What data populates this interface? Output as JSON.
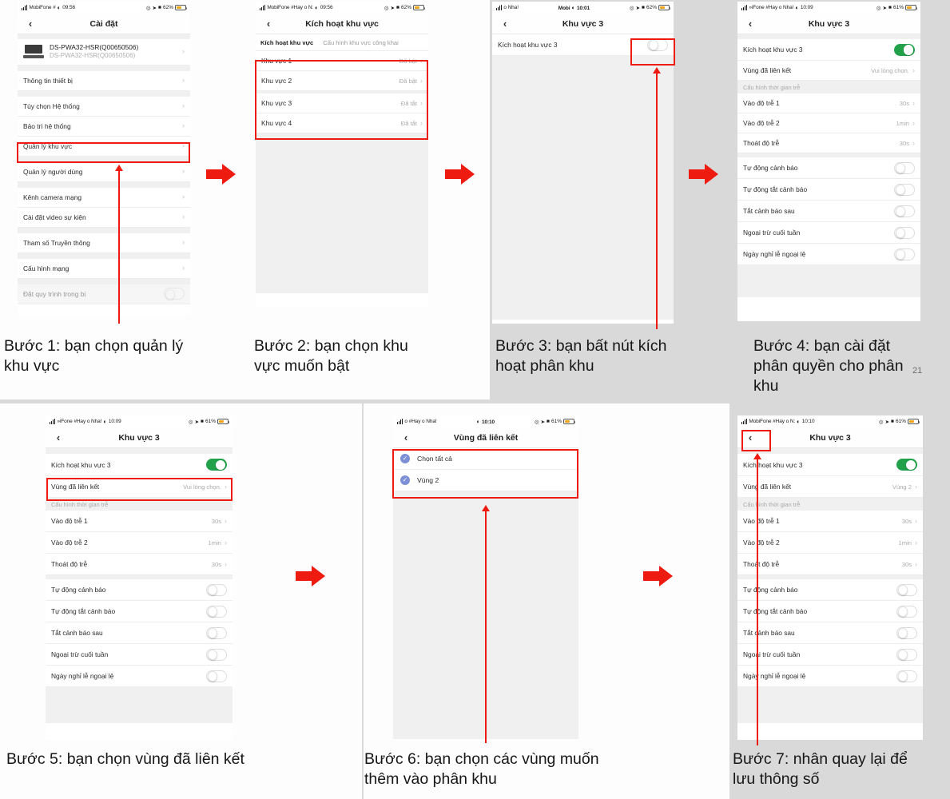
{
  "document": {
    "page_number": "21",
    "accent_color": "#ee1b11",
    "toggle_on_color": "#22a04a",
    "checkbox_color": "#7d8fd6"
  },
  "captions": [
    {
      "id": "step1",
      "text": "Bước 1: bạn chọn quản lý khu vực"
    },
    {
      "id": "step2",
      "text": "Bước 2: bạn chọn khu vực muốn bật"
    },
    {
      "id": "step3",
      "text": "Bước 3: bạn bất nút kích hoạt phân khu"
    },
    {
      "id": "step4",
      "text": "Bước 4: bạn cài đặt phân quyền cho phân khu"
    },
    {
      "id": "step5",
      "text": "Bước 5: bạn chọn vùng đã liên kết"
    },
    {
      "id": "step6",
      "text": "Bước 6: bạn chọn các vùng muốn thêm vào phân khu"
    },
    {
      "id": "step7",
      "text": "Bước 7: nhân quay lại để lưu thông số"
    }
  ],
  "screens": {
    "s1": {
      "status": {
        "carrier": "MobiFone #",
        "time": "09:56",
        "battery": "62%"
      },
      "nav": {
        "back_icon": "chevron-left-icon",
        "title": "Cài đặt"
      },
      "device": {
        "name": "DS-PWA32-HSR(Q00650506)",
        "serial": "DS-PWA32-HSR(Q00650506)"
      },
      "rows": [
        {
          "label": "Thông tin thiết bị",
          "kind": "chevron"
        },
        {
          "label": "Tùy chọn Hệ thống",
          "kind": "chevron"
        },
        {
          "label": "Bảo trì hệ thống",
          "kind": "chevron"
        },
        {
          "label": "Quản lý khu vực",
          "kind": "chevron",
          "highlight": true
        },
        {
          "label": "Quản lý người dùng",
          "kind": "chevron"
        },
        {
          "label": "Kênh camera mạng",
          "kind": "chevron"
        },
        {
          "label": "Cài đặt video sự kiện",
          "kind": "chevron"
        },
        {
          "label": "Tham số Truyền thông",
          "kind": "chevron"
        },
        {
          "label": "Cấu hình mạng",
          "kind": "chevron"
        },
        {
          "label": "Đặt quy trình trong bị",
          "kind": "toggle",
          "value": "off"
        }
      ]
    },
    "s2": {
      "status": {
        "carrier": "MobiFone #Hay o N:",
        "time": "09:56",
        "battery": "62%"
      },
      "nav": {
        "back_icon": "chevron-left-icon",
        "title": "Kích hoạt khu vực"
      },
      "tabs": [
        {
          "label": "Kích hoạt khu vực",
          "active": true
        },
        {
          "label": "Cấu hình khu vực công khai",
          "active": false
        }
      ],
      "rows": [
        {
          "label": "Khu vực 1",
          "value": "Đã bật"
        },
        {
          "label": "Khu vực 2",
          "value": "Đã bật"
        },
        {
          "label": "Khu vực 3",
          "value": "Đã tắt"
        },
        {
          "label": "Khu vực 4",
          "value": "Đã tắt"
        }
      ]
    },
    "s3": {
      "status": {
        "carrier": "o Nha!",
        "carrier2": "Mobi",
        "time": "10:01",
        "battery": "62%"
      },
      "nav": {
        "back_icon": "chevron-left-icon",
        "title": "Khu vực 3"
      },
      "rows": [
        {
          "label": "Kích hoạt khu vực 3",
          "kind": "toggle",
          "value": "off"
        }
      ]
    },
    "s4": {
      "status": {
        "carrier": "»iFone #Hay o Nha!",
        "time": "10:09",
        "battery": "61%"
      },
      "nav": {
        "back_icon": "chevron-left-icon",
        "title": "Khu vực 3"
      },
      "rows": [
        {
          "label": "Kích hoạt khu vực 3",
          "kind": "toggle",
          "value": "on"
        },
        {
          "label": "Vùng đã liên kết",
          "kind": "chevron",
          "value": "Vui lòng chọn."
        },
        {
          "label": "Cấu hình thời gian trễ",
          "kind": "header"
        },
        {
          "label": "Vào độ trễ 1",
          "kind": "chevron",
          "value": "30s"
        },
        {
          "label": "Vào độ trễ 2",
          "kind": "chevron",
          "value": "1min"
        },
        {
          "label": "Thoát độ trễ",
          "kind": "chevron",
          "value": "30s"
        },
        {
          "label": "Tự động cảnh báo",
          "kind": "toggle",
          "value": "off"
        },
        {
          "label": "Tự động tắt cảnh báo",
          "kind": "toggle",
          "value": "off"
        },
        {
          "label": "Tắt cảnh báo sau",
          "kind": "toggle",
          "value": "off"
        },
        {
          "label": "Ngoại trừ cuối tuần",
          "kind": "toggle",
          "value": "off"
        },
        {
          "label": "Ngày nghỉ lễ ngoại lệ",
          "kind": "toggle",
          "value": "off"
        }
      ]
    },
    "s5": {
      "status": {
        "carrier": "»iFone #Hay o Nha!",
        "time": "10:09",
        "battery": "61%"
      },
      "nav": {
        "back_icon": "chevron-left-icon",
        "title": "Khu vực 3"
      },
      "rows": [
        {
          "label": "Kích hoạt khu vực 3",
          "kind": "toggle",
          "value": "on"
        },
        {
          "label": "Vùng đã liên kết",
          "kind": "chevron",
          "value": "Vui lòng chọn.",
          "highlight": true
        },
        {
          "label": "Cấu hình thời gian trễ",
          "kind": "header"
        },
        {
          "label": "Vào độ trễ 1",
          "kind": "chevron",
          "value": "30s"
        },
        {
          "label": "Vào độ trễ 2",
          "kind": "chevron",
          "value": "1min"
        },
        {
          "label": "Thoát độ trễ",
          "kind": "chevron",
          "value": "30s"
        },
        {
          "label": "Tự động cảnh báo",
          "kind": "toggle",
          "value": "off"
        },
        {
          "label": "Tự động tắt cảnh báo",
          "kind": "toggle",
          "value": "off"
        },
        {
          "label": "Tắt cảnh báo sau",
          "kind": "toggle",
          "value": "off"
        },
        {
          "label": "Ngoại trừ cuối tuần",
          "kind": "toggle",
          "value": "off"
        },
        {
          "label": "Ngày nghỉ lễ ngoại lệ",
          "kind": "toggle",
          "value": "off"
        }
      ]
    },
    "s6": {
      "status": {
        "carrier": "o #Hay o Nha!",
        "time": "10:10",
        "battery": "61%"
      },
      "nav": {
        "back_icon": "chevron-left-icon",
        "title": "Vùng đã liên kết"
      },
      "checks": [
        {
          "label": "Chọn tất cả",
          "checked": true
        },
        {
          "label": "Vùng 2",
          "checked": true
        }
      ]
    },
    "s7": {
      "status": {
        "carrier": "MobiFone #Hay o N:",
        "time": "10:10",
        "battery": "61%"
      },
      "nav": {
        "back_icon": "chevron-left-icon",
        "title": "Khu vực 3"
      },
      "rows": [
        {
          "label": "Kích hoạt khu vực 3",
          "kind": "toggle",
          "value": "on"
        },
        {
          "label": "Vùng đã liên kết",
          "kind": "chevron",
          "value": "Vùng 2"
        },
        {
          "label": "Cấu hình thời gian trễ",
          "kind": "header"
        },
        {
          "label": "Vào độ trễ 1",
          "kind": "chevron",
          "value": "30s"
        },
        {
          "label": "Vào độ trễ 2",
          "kind": "chevron",
          "value": "1min"
        },
        {
          "label": "Thoát độ trễ",
          "kind": "chevron",
          "value": "30s"
        },
        {
          "label": "Tự động cảnh báo",
          "kind": "toggle",
          "value": "off"
        },
        {
          "label": "Tự động tắt cảnh báo",
          "kind": "toggle",
          "value": "off"
        },
        {
          "label": "Tắt cảnh báo sau",
          "kind": "toggle",
          "value": "off"
        },
        {
          "label": "Ngoại trừ cuối tuần",
          "kind": "toggle",
          "value": "off"
        },
        {
          "label": "Ngày nghỉ lễ ngoại lệ",
          "kind": "toggle",
          "value": "off"
        }
      ]
    }
  }
}
